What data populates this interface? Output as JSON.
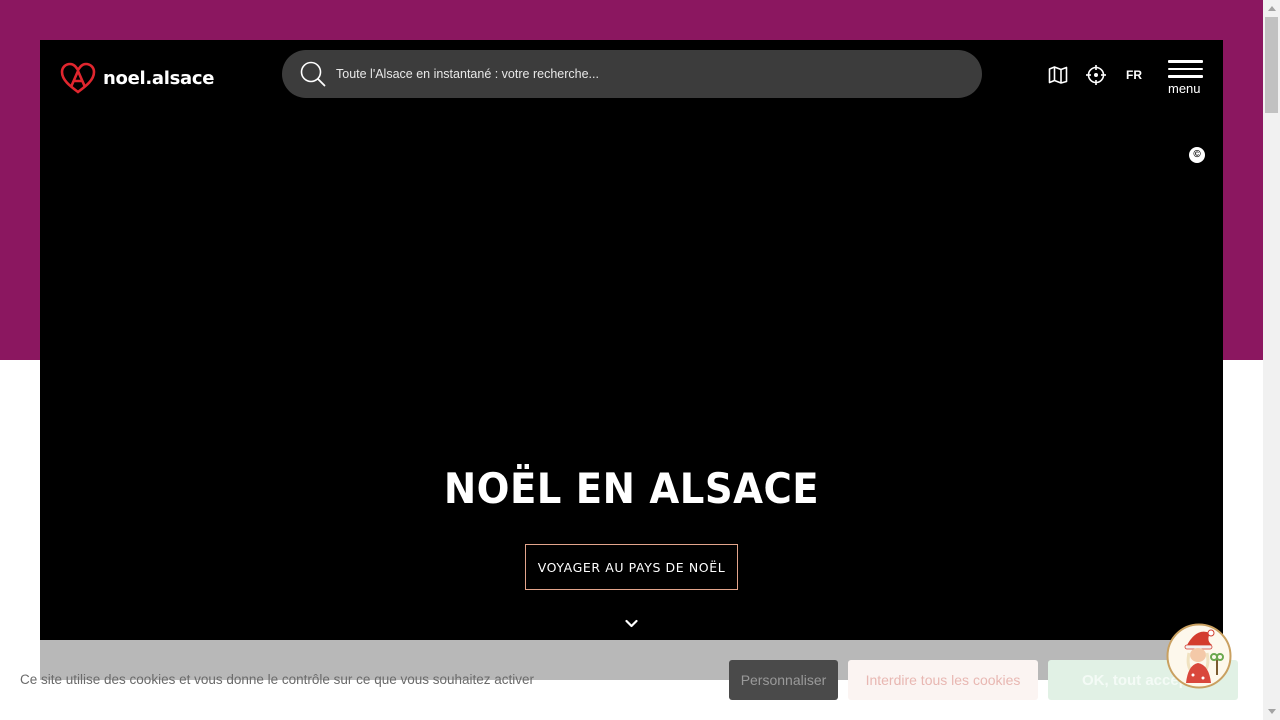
{
  "colors": {
    "band": "#8b1760",
    "hero_bg": "#000000",
    "cta_border": "#e3a58c",
    "logo_red": "#e0262e"
  },
  "header": {
    "logo_text": "noel.alsace",
    "search_placeholder": "Toute l'Alsace en instantané : votre recherche...",
    "lang": "FR",
    "menu_label": "menu",
    "icons": [
      "map-icon",
      "locate-icon"
    ]
  },
  "hero": {
    "copyright": "©",
    "title": "NOËL EN ALSACE",
    "cta_label": "VOYAGER AU PAYS DE NOËL"
  },
  "cookie": {
    "text": "Ce site utilise des cookies et vous donne le contrôle sur ce que vous souhaitez activer",
    "customize_label": "Personnaliser",
    "deny_label": "Interdire tous les cookies",
    "accept_label": "OK, tout accepter"
  }
}
